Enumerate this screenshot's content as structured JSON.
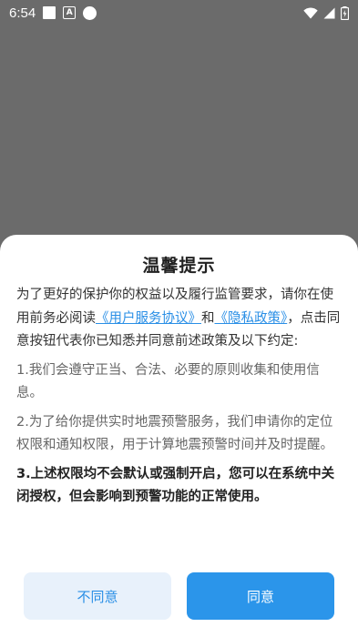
{
  "status_bar": {
    "time": "6:54",
    "a_label": "A"
  },
  "dialog": {
    "title": "温馨提示",
    "intro_prefix": "为了更好的保护你的权益以及履行监管要求，请你在使用前务必阅读",
    "link_user_agreement": "《用户服务协议》",
    "and_text": "和",
    "link_privacy": "《隐私政策》",
    "intro_suffix": "，点击同意按钮代表你已知悉并同意前述政策及以下约定:",
    "item1": "1.我们会遵守正当、合法、必要的原则收集和使用信息。",
    "item2": "2.为了给你提供实时地震预警服务，我们申请你的定位权限和通知权限，用于计算地震预警时间并及时提醒。",
    "item3": "3.上述权限均不会默认或强制开启，您可以在系统中关闭授权，但会影响到预警功能的正常使用。",
    "disagree_label": "不同意",
    "agree_label": "同意"
  },
  "colors": {
    "accent": "#2b95ea",
    "link": "#2a8fe6",
    "overlay": "#6b6b6b"
  }
}
